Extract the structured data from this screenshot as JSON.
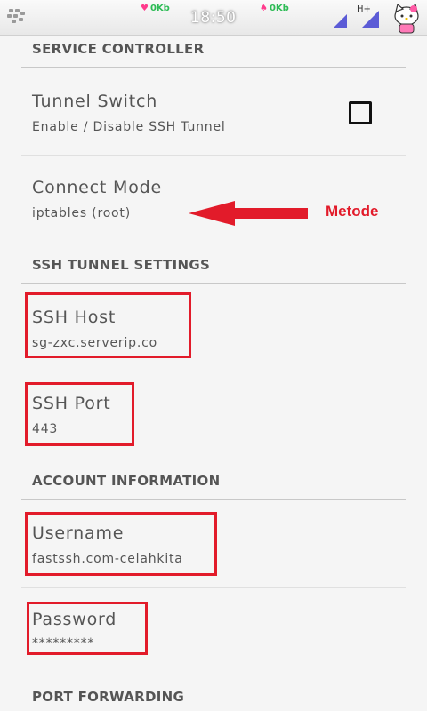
{
  "status_bar": {
    "down_rate": "0Kb",
    "up_rate": "0Kb",
    "time": "18:50",
    "network_type": "H+",
    "down_symbol": "♥",
    "up_symbol": "♠"
  },
  "sections": {
    "service_controller": "SERVICE CONTROLLER",
    "ssh_tunnel_settings": "SSH TUNNEL SETTINGS",
    "account_information": "ACCOUNT INFORMATION",
    "port_forwarding": "PORT FORWARDING"
  },
  "tunnel_switch": {
    "title": "Tunnel Switch",
    "summary": "Enable / Disable SSH Tunnel",
    "checked": false
  },
  "connect_mode": {
    "title": "Connect Mode",
    "summary": "iptables (root)"
  },
  "annotation": {
    "label": "Metode",
    "color": "#e21b2a"
  },
  "ssh_host": {
    "title": "SSH Host",
    "summary": "sg-zxc.serverip.co"
  },
  "ssh_port": {
    "title": "SSH Port",
    "summary": "443"
  },
  "username": {
    "title": "Username",
    "summary": "fastssh.com-celahkita"
  },
  "password": {
    "title": "Password",
    "summary": "*********"
  },
  "icons": {
    "blackberry": "blackberry-logo-icon",
    "signal": "signal-strength-icon",
    "avatar": "hello-kitty-icon"
  }
}
